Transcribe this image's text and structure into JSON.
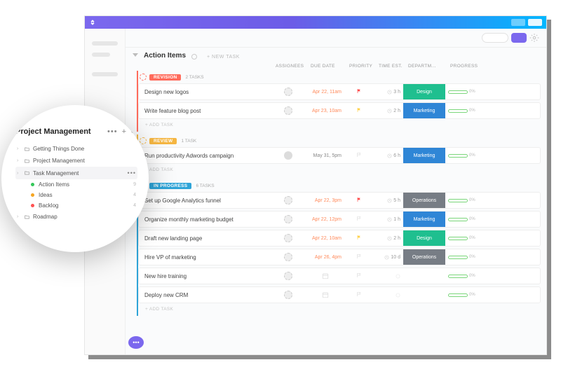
{
  "colors": {
    "revision": "#ff6b5b",
    "review": "#f5b642",
    "progress": "#2ea4d8",
    "design": "#1fbf8f",
    "marketing": "#2f86d6",
    "operations": "#777d85",
    "green": "#34c759",
    "orange": "#f5a623",
    "red": "#ff5252"
  },
  "topnav": {
    "section": "Action Items",
    "newtask": "+ NEW TASK"
  },
  "columns": {
    "assignees": "ASSIGNEES",
    "due": "DUE DATE",
    "priority": "PRIORITY",
    "time": "TIME EST.",
    "dept": "DEPARTM...",
    "progress": "PROGRESS"
  },
  "addtask": "+ ADD TASK",
  "groups": [
    {
      "key": "revision",
      "label": "REVISION",
      "count": "2 TASKS",
      "pill": "#ff6b5b",
      "circle": "dotted",
      "tasks": [
        {
          "name": "Design new logos",
          "due": "Apr 22, 11am",
          "dueColor": "#ff8a5b",
          "flag": "#ff4d4d",
          "time": "3 h",
          "dept": "Design",
          "deptColor": "#1fbf8f",
          "pct": "0%",
          "avatar": "ph"
        },
        {
          "name": "Write feature blog post",
          "due": "Apr 23, 10am",
          "dueColor": "#ff8a5b",
          "flag": "#ffd24d",
          "time": "2 h",
          "dept": "Marketing",
          "deptColor": "#2f86d6",
          "pct": "0%",
          "avatar": "ph"
        }
      ]
    },
    {
      "key": "review",
      "label": "REVIEW",
      "count": "1 TASK",
      "pill": "#f5b642",
      "circle": "dotted",
      "tasks": [
        {
          "name": "Run productivity Adwords campaign",
          "due": "May 31, 5pm",
          "dueColor": "#888",
          "flag": "none",
          "time": "6 h",
          "dept": "Marketing",
          "deptColor": "#2f86d6",
          "pct": "0%",
          "avatar": "full"
        }
      ]
    },
    {
      "key": "inprogress",
      "label": "IN PROGRESS",
      "count": "6 TASKS",
      "pill": "#2ea4d8",
      "circle": "solid",
      "tasks": [
        {
          "name": "Set up Google Analytics funnel",
          "due": "Apr 22, 3pm",
          "dueColor": "#ff8a5b",
          "flag": "#ff4d4d",
          "time": "5 h",
          "dept": "Operations",
          "deptColor": "#777d85",
          "pct": "0%",
          "avatar": "ph"
        },
        {
          "name": "Organize monthly marketing budget",
          "due": "Apr 22, 12pm",
          "dueColor": "#ff8a5b",
          "flag": "none",
          "time": "1 h",
          "dept": "Marketing",
          "deptColor": "#2f86d6",
          "pct": "0%",
          "avatar": "ph"
        },
        {
          "name": "Draft new landing page",
          "due": "Apr 22, 10am",
          "dueColor": "#ff8a5b",
          "flag": "#ffd24d",
          "time": "2 h",
          "dept": "Design",
          "deptColor": "#1fbf8f",
          "pct": "0%",
          "avatar": "ph"
        },
        {
          "name": "Hire VP of marketing",
          "due": "Apr 26, 4pm",
          "dueColor": "#ff8a5b",
          "flag": "none",
          "time": "10 d",
          "dept": "Operations",
          "deptColor": "#777d85",
          "pct": "0%",
          "avatar": "ph"
        },
        {
          "name": "New hire training",
          "due": "",
          "dueColor": "#bbb",
          "flag": "none",
          "time": "",
          "dept": "",
          "deptColor": "",
          "pct": "0%",
          "avatar": "ph",
          "empty": true
        },
        {
          "name": "Deploy new CRM",
          "due": "",
          "dueColor": "#bbb",
          "flag": "none",
          "time": "",
          "dept": "",
          "deptColor": "",
          "pct": "0%",
          "avatar": "ph",
          "empty": true
        }
      ]
    }
  ],
  "lens": {
    "title": "Project Management",
    "items": [
      {
        "label": "Getting Things Done",
        "type": "proj"
      },
      {
        "label": "Project Management",
        "type": "proj"
      },
      {
        "label": "Task Management",
        "type": "proj",
        "selected": true
      },
      {
        "label": "Roadmap",
        "type": "proj"
      }
    ],
    "subitems": [
      {
        "dot": "#34c759",
        "label": "Action Items",
        "count": "9"
      },
      {
        "dot": "#f5a623",
        "label": "Ideas",
        "count": "4"
      },
      {
        "dot": "#ff5252",
        "label": "Backlog",
        "count": "4"
      }
    ]
  }
}
